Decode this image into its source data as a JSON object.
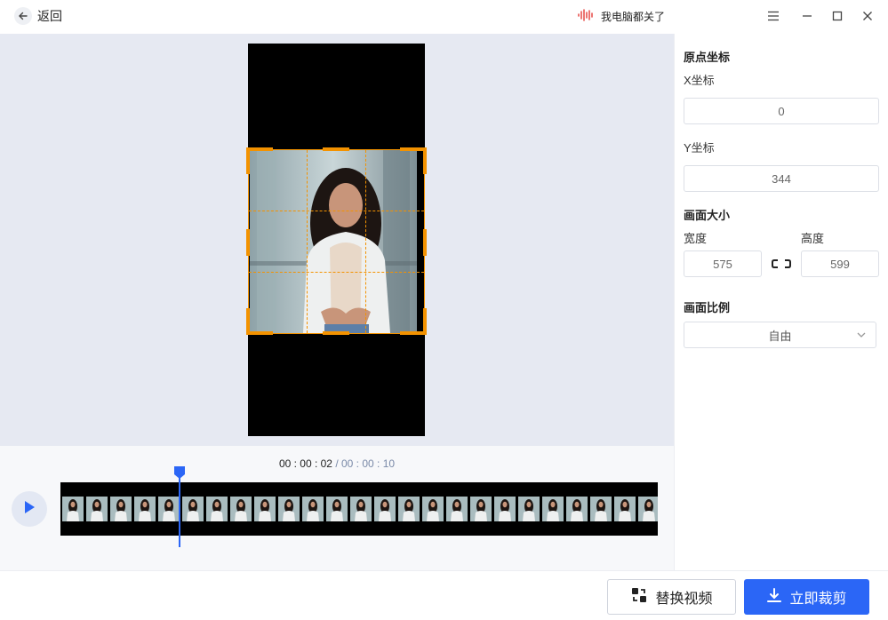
{
  "titlebar": {
    "back_label": "返回",
    "app_name": "我电脑都关了"
  },
  "player": {
    "current_time": "00 : 00 : 02",
    "separator": " / ",
    "total_time": "00 : 00 : 10",
    "thumbnail_count": 25,
    "playhead_progress": 0.2
  },
  "panel": {
    "origin_title": "原点坐标",
    "x_label": "X坐标",
    "x_value": "0",
    "y_label": "Y坐标",
    "y_value": "344",
    "size_title": "画面大小",
    "width_label": "宽度",
    "width_value": "575",
    "height_label": "高度",
    "height_value": "599",
    "ratio_title": "画面比例",
    "ratio_value": "自由"
  },
  "actions": {
    "replace_label": "替换视频",
    "crop_label": "立即裁剪"
  },
  "colors": {
    "accent": "#2b66f6",
    "crop_border": "#f39200",
    "preview_bg": "#e6e9f2"
  },
  "icons": [
    "back-arrow-icon",
    "sound-wave-icon",
    "menu-icon",
    "minimize-icon",
    "maximize-icon",
    "close-icon",
    "play-icon",
    "link-icon",
    "chevron-down-icon",
    "replace-icon",
    "download-icon"
  ]
}
